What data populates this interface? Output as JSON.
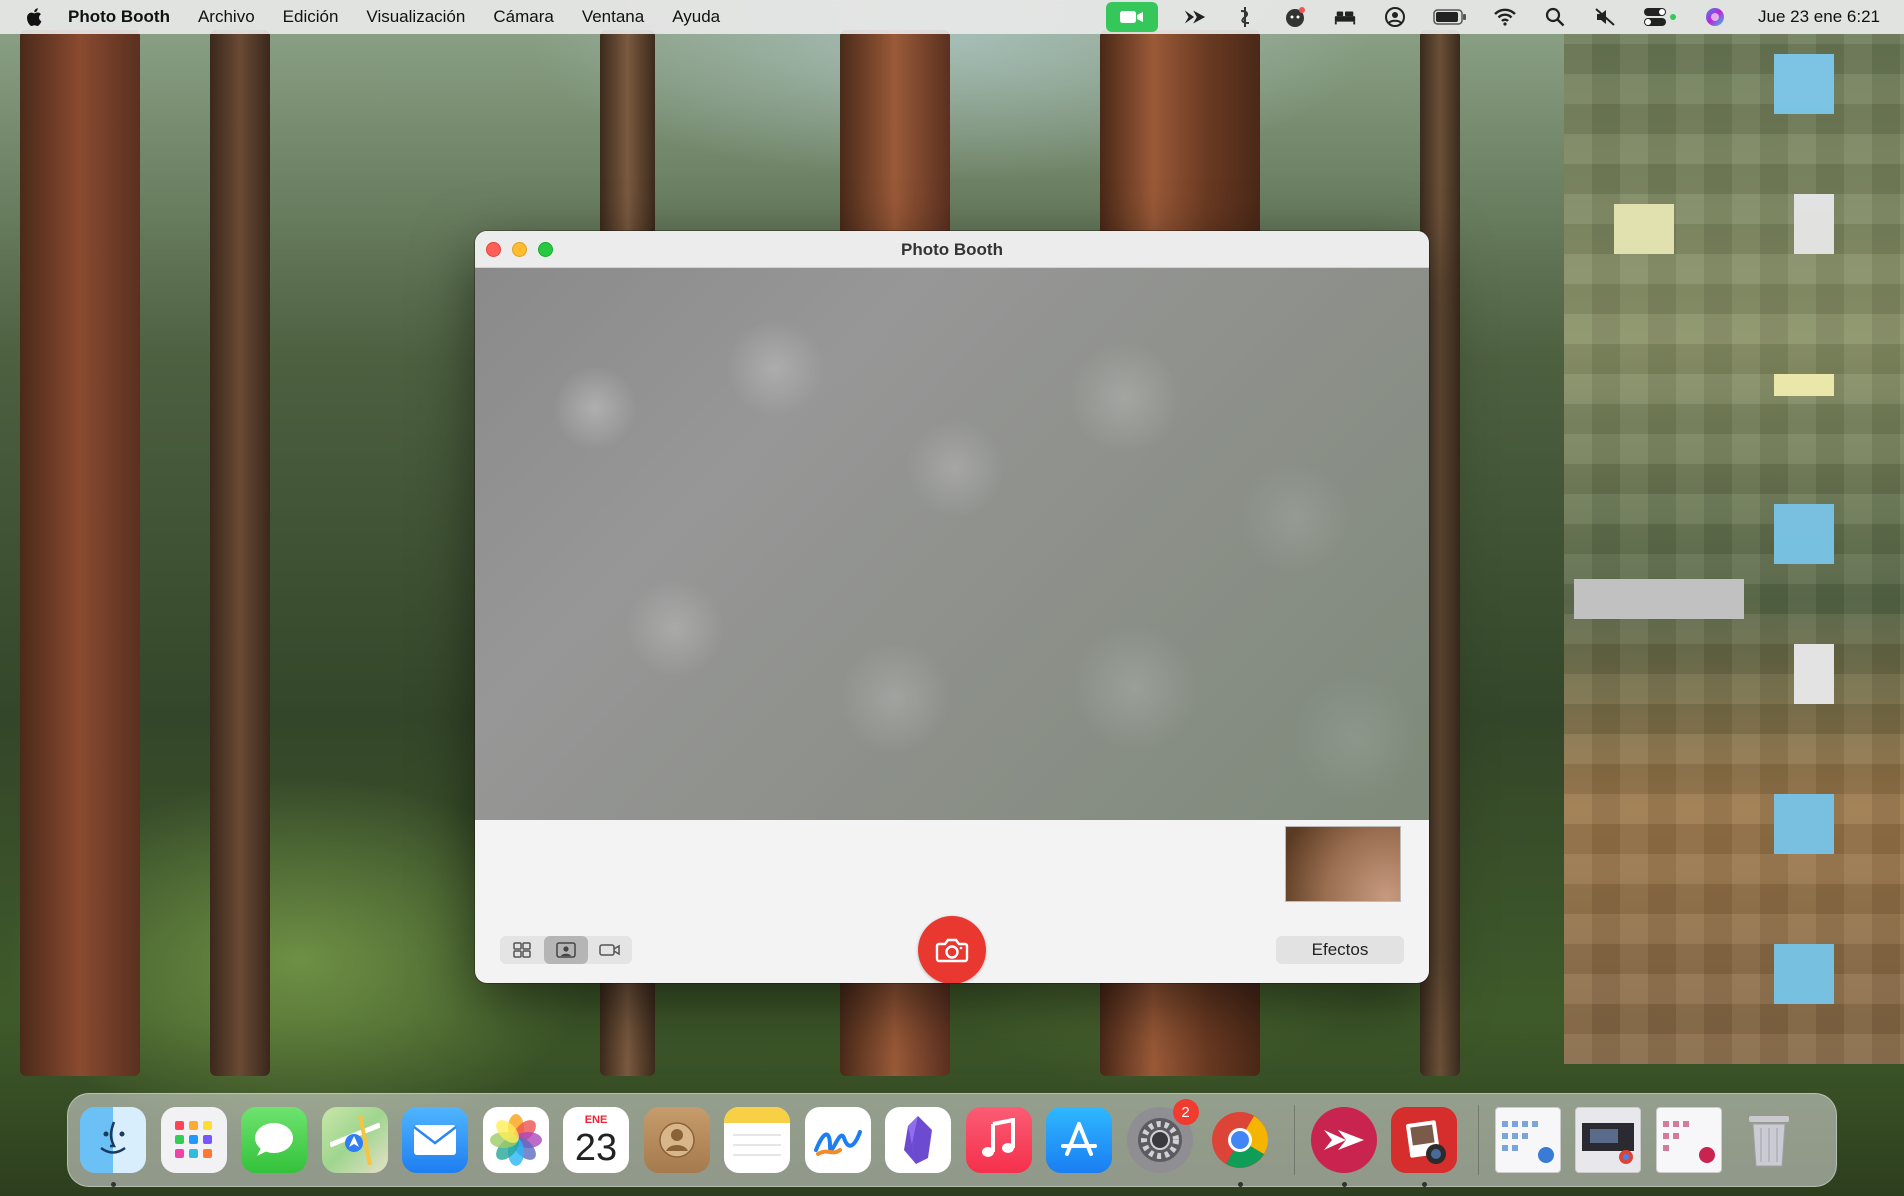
{
  "menubar": {
    "app_name": "Photo Booth",
    "menus": [
      "Archivo",
      "Edición",
      "Visualización",
      "Cámara",
      "Ventana",
      "Ayuda"
    ],
    "clock": "Jue 23 ene 6:21",
    "status_icons": [
      "camera-in-use-icon",
      "swift-icon",
      "script-icon",
      "face-icon",
      "bed-icon",
      "user-icon",
      "battery-icon",
      "wifi-icon",
      "search-icon",
      "mute-icon",
      "control-center-icon",
      "siri-icon"
    ]
  },
  "window": {
    "title": "Photo Booth",
    "effects_label": "Efectos",
    "modes": [
      "grid-mode",
      "single-photo-mode",
      "video-mode"
    ],
    "active_mode": "single-photo-mode"
  },
  "dock": {
    "calendar_month": "ENE",
    "calendar_day": "23",
    "settings_badge": "2",
    "apps": [
      "Finder",
      "Launchpad",
      "Messages",
      "Maps",
      "Mail",
      "Photos",
      "Calendar",
      "Contacts",
      "Notes",
      "Freeform",
      "Obsidian",
      "Music",
      "App Store",
      "System Settings",
      "Chrome",
      "Swift Playgrounds",
      "Photo Booth"
    ],
    "running": [
      "Finder",
      "Chrome",
      "Swift Playgrounds",
      "Photo Booth"
    ]
  },
  "colors": {
    "shutter": "#e8382f",
    "camera_indicator": "#35c759",
    "badge": "#f23b30"
  }
}
